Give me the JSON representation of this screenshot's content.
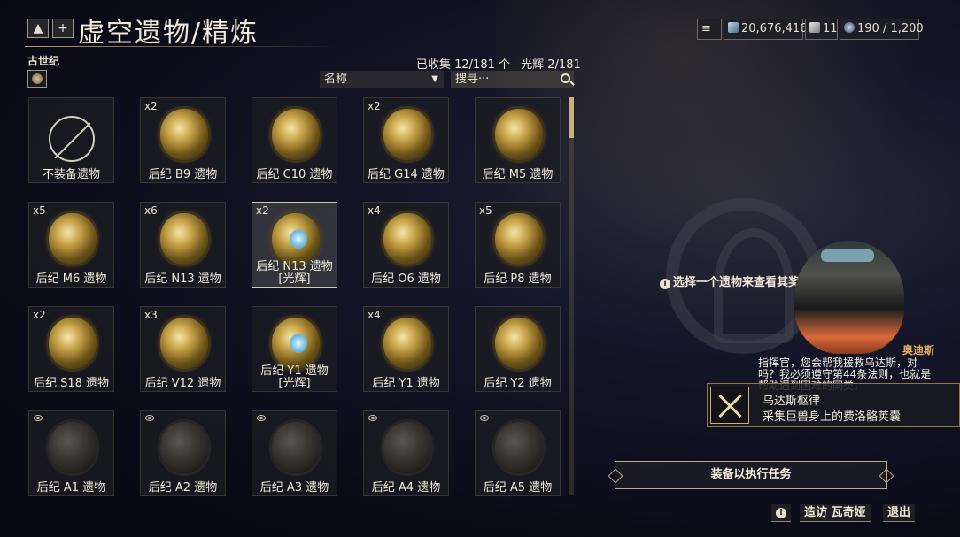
{
  "header": {
    "title": "虚空遗物/精炼",
    "era": "古世纪"
  },
  "currency": {
    "credits": "20,676,416",
    "endo": "11",
    "slots": "190 / 1,200"
  },
  "collection": {
    "text": "已收集 12/181 个",
    "radiant_text": "光辉 2/181"
  },
  "filters": {
    "sort_label": "名称",
    "search_placeholder": "搜寻···"
  },
  "relics": [
    {
      "qty": "",
      "name": "不装备遗物",
      "type": "none"
    },
    {
      "qty": "x2",
      "name": "后纪 B9 遗物",
      "type": "owned"
    },
    {
      "qty": "",
      "name": "后纪 C10 遗物",
      "type": "owned"
    },
    {
      "qty": "x2",
      "name": "后纪 G14 遗物",
      "type": "owned"
    },
    {
      "qty": "",
      "name": "后纪 M5 遗物",
      "type": "owned"
    },
    {
      "qty": "x5",
      "name": "后纪 M6 遗物",
      "type": "owned"
    },
    {
      "qty": "x6",
      "name": "后纪 N13 遗物",
      "type": "owned"
    },
    {
      "qty": "x2",
      "name": "后纪 N13 遗物",
      "name2": "[光辉]",
      "type": "radiant"
    },
    {
      "qty": "x4",
      "name": "后纪 O6 遗物",
      "type": "owned"
    },
    {
      "qty": "x5",
      "name": "后纪 P8 遗物",
      "type": "owned"
    },
    {
      "qty": "x2",
      "name": "后纪 S18 遗物",
      "type": "owned"
    },
    {
      "qty": "x3",
      "name": "后纪 V12 遗物",
      "type": "owned"
    },
    {
      "qty": "",
      "name": "后纪 Y1 遗物",
      "name2": "[光辉]",
      "type": "radiant"
    },
    {
      "qty": "x4",
      "name": "后纪 Y1 遗物",
      "type": "owned"
    },
    {
      "qty": "",
      "name": "后纪 Y2 遗物",
      "type": "owned"
    },
    {
      "qty": "",
      "name": "后纪 A1 遗物",
      "type": "vaulted"
    },
    {
      "qty": "",
      "name": "后纪 A2 遗物",
      "type": "vaulted"
    },
    {
      "qty": "",
      "name": "后纪 A3 遗物",
      "type": "vaulted"
    },
    {
      "qty": "",
      "name": "后纪 A4 遗物",
      "type": "vaulted"
    },
    {
      "qty": "",
      "name": "后纪 A5 遗物",
      "type": "vaulted"
    }
  ],
  "right": {
    "hint": "选择一个遗物来查看其奖励",
    "speaker": "奥迪斯",
    "dialogue": "指挥官，您会帮我援救乌达斯，对吗？我必须遵守第44条法则，也就是帮助遇到困难的同类。",
    "quest_title": "乌达斯枢律",
    "quest_desc": "采集巨兽身上的费洛骼荚囊",
    "equip_label": "装备以执行任务"
  },
  "footer": {
    "visit_label": "造访 瓦奇娅",
    "exit_label": "退出"
  },
  "colors": {
    "accent": "#c8b27a",
    "speaker": "#e8b060",
    "background": "#0b0b18"
  }
}
